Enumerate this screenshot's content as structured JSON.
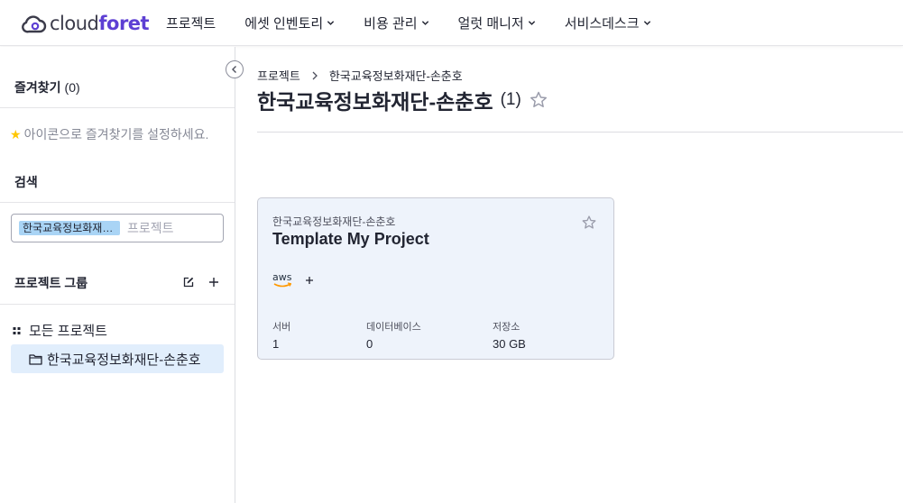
{
  "logo": {
    "text_a": "cloud",
    "text_b": "foret"
  },
  "nav": {
    "items": [
      {
        "label": "프로젝트",
        "has_dropdown": false
      },
      {
        "label": "에셋 인벤토리",
        "has_dropdown": true
      },
      {
        "label": "비용 관리",
        "has_dropdown": true
      },
      {
        "label": "얼럿 매니저",
        "has_dropdown": true
      },
      {
        "label": "서비스데스크",
        "has_dropdown": true
      }
    ]
  },
  "sidebar": {
    "favorites": {
      "title": "즐겨찾기",
      "count": "(0)",
      "hint": "아이콘으로 즐겨찾기를 설정하세요.",
      "hint_icon": "star-icon"
    },
    "search": {
      "title": "검색",
      "tag": "한국교육정보화재단-손춘호",
      "placeholder": "프로젝트"
    },
    "project_group": {
      "title": "프로젝트 그룹",
      "all_label": "모든 프로젝트",
      "selected_label": "한국교육정보화재단-손춘호"
    }
  },
  "main": {
    "breadcrumb": {
      "root": "프로젝트",
      "current": "한국교육정보화재단-손춘호"
    },
    "title": "한국교육정보화재단-손춘호",
    "count": "(1)",
    "cards": [
      {
        "group": "한국교육정보화재단-손춘호",
        "name": "Template My Project",
        "provider": "aws",
        "stats": [
          {
            "label": "서버",
            "value": "1"
          },
          {
            "label": "데이터베이스",
            "value": "0"
          },
          {
            "label": "저장소",
            "value": "30 GB"
          }
        ]
      }
    ]
  },
  "colors": {
    "brand": "#5d3fd3",
    "selected_bg": "#e1eefc",
    "tag_bg": "#a9d4f5",
    "card_bg": "#eef3fb",
    "aws_orange": "#ff9900"
  }
}
